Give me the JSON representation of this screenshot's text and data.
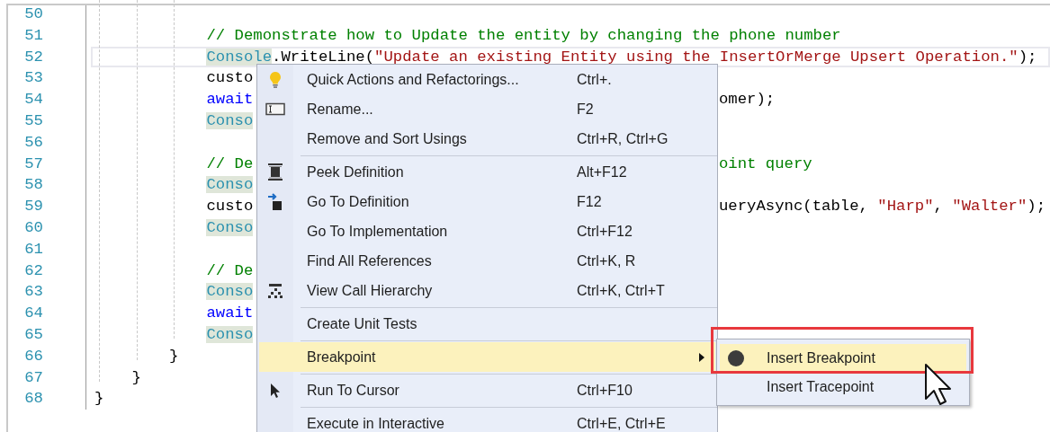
{
  "editor": {
    "lines": [
      {
        "number": "50",
        "current": false
      },
      {
        "number": "51",
        "current": false,
        "left": [
          {
            "text": "            // Demonstrate how to Update the entity by changing the phone number",
            "kind": "comment"
          }
        ]
      },
      {
        "number": "52",
        "current": true,
        "left": [
          {
            "text": "            Console",
            "kind": "type-ref"
          },
          {
            "text": ".WriteLine(",
            "kind": "plain"
          },
          {
            "text": "\"Update an existing Entity using the InsertOrMerge Upsert Operation.\"",
            "kind": "string"
          },
          {
            "text": ");",
            "kind": "plain"
          }
        ]
      },
      {
        "number": "53",
        "current": false,
        "left": [
          {
            "text": "            custo",
            "kind": "plain"
          }
        ]
      },
      {
        "number": "54",
        "current": false,
        "left": [
          {
            "text": "            await",
            "kind": "keyword"
          }
        ],
        "right": [
          {
            "text": "omer);",
            "kind": "plain"
          }
        ]
      },
      {
        "number": "55",
        "current": false,
        "left": [
          {
            "text": "            Conso",
            "kind": "type-ref"
          }
        ]
      },
      {
        "number": "56",
        "current": false
      },
      {
        "number": "57",
        "current": false,
        "left": [
          {
            "text": "            // De",
            "kind": "comment"
          }
        ],
        "right": [
          {
            "text": "oint query",
            "kind": "comment"
          }
        ]
      },
      {
        "number": "58",
        "current": false,
        "left": [
          {
            "text": "            Conso",
            "kind": "type-ref"
          }
        ]
      },
      {
        "number": "59",
        "current": false,
        "left": [
          {
            "text": "            custo",
            "kind": "plain"
          }
        ],
        "right": [
          {
            "text": "ueryAsync(table, ",
            "kind": "plain"
          },
          {
            "text": "\"Harp\"",
            "kind": "string"
          },
          {
            "text": ", ",
            "kind": "plain"
          },
          {
            "text": "\"Walter\"",
            "kind": "string"
          },
          {
            "text": ");",
            "kind": "plain"
          }
        ]
      },
      {
        "number": "60",
        "current": false,
        "left": [
          {
            "text": "            Conso",
            "kind": "type-ref"
          }
        ]
      },
      {
        "number": "61",
        "current": false
      },
      {
        "number": "62",
        "current": false,
        "left": [
          {
            "text": "            // De",
            "kind": "comment"
          }
        ]
      },
      {
        "number": "63",
        "current": false,
        "left": [
          {
            "text": "            Conso",
            "kind": "type-ref"
          }
        ]
      },
      {
        "number": "64",
        "current": false,
        "left": [
          {
            "text": "            await",
            "kind": "keyword"
          }
        ]
      },
      {
        "number": "65",
        "current": false,
        "left": [
          {
            "text": "            Conso",
            "kind": "type-ref"
          }
        ]
      },
      {
        "number": "66",
        "current": false,
        "left": [
          {
            "text": "        }",
            "kind": "plain"
          }
        ]
      },
      {
        "number": "67",
        "current": false,
        "left": [
          {
            "text": "    }",
            "kind": "plain"
          }
        ]
      },
      {
        "number": "68",
        "current": false,
        "left": [
          {
            "text": "}",
            "kind": "plain"
          }
        ]
      }
    ]
  },
  "context_menu": {
    "groups": [
      [
        {
          "label": "Quick Actions and Refactorings...",
          "shortcut": "Ctrl+.",
          "kind": "lightbulb",
          "selected": false
        },
        {
          "label": "Rename...",
          "shortcut": "F2",
          "kind": "rename",
          "selected": false
        },
        {
          "label": "Remove and Sort Usings",
          "shortcut": "Ctrl+R, Ctrl+G",
          "kind": "plain",
          "selected": false
        }
      ],
      [
        {
          "label": "Peek Definition",
          "shortcut": "Alt+F12",
          "kind": "peek",
          "selected": false
        },
        {
          "label": "Go To Definition",
          "shortcut": "F12",
          "kind": "goto",
          "selected": false
        },
        {
          "label": "Go To Implementation",
          "shortcut": "Ctrl+F12",
          "kind": "plain",
          "selected": false
        },
        {
          "label": "Find All References",
          "shortcut": "Ctrl+K, R",
          "kind": "plain",
          "selected": false
        },
        {
          "label": "View Call Hierarchy",
          "shortcut": "Ctrl+K, Ctrl+T",
          "kind": "hierarchy",
          "selected": false
        }
      ],
      [
        {
          "label": "Create Unit Tests",
          "kind": "plain",
          "selected": false
        }
      ],
      [
        {
          "label": "Breakpoint",
          "kind": "submenu",
          "selected": true
        }
      ],
      [
        {
          "label": "Run To Cursor",
          "shortcut": "Ctrl+F10",
          "kind": "cursor",
          "selected": false
        }
      ],
      [
        {
          "label": "Execute in Interactive",
          "shortcut": "Ctrl+E, Ctrl+E",
          "kind": "plain",
          "selected": false
        }
      ]
    ]
  },
  "submenu": {
    "items": [
      {
        "label": "Insert Breakpoint",
        "kind": "breakpoint",
        "selected": true
      },
      {
        "label": "Insert Tracepoint",
        "kind": "plain",
        "selected": false
      }
    ]
  }
}
